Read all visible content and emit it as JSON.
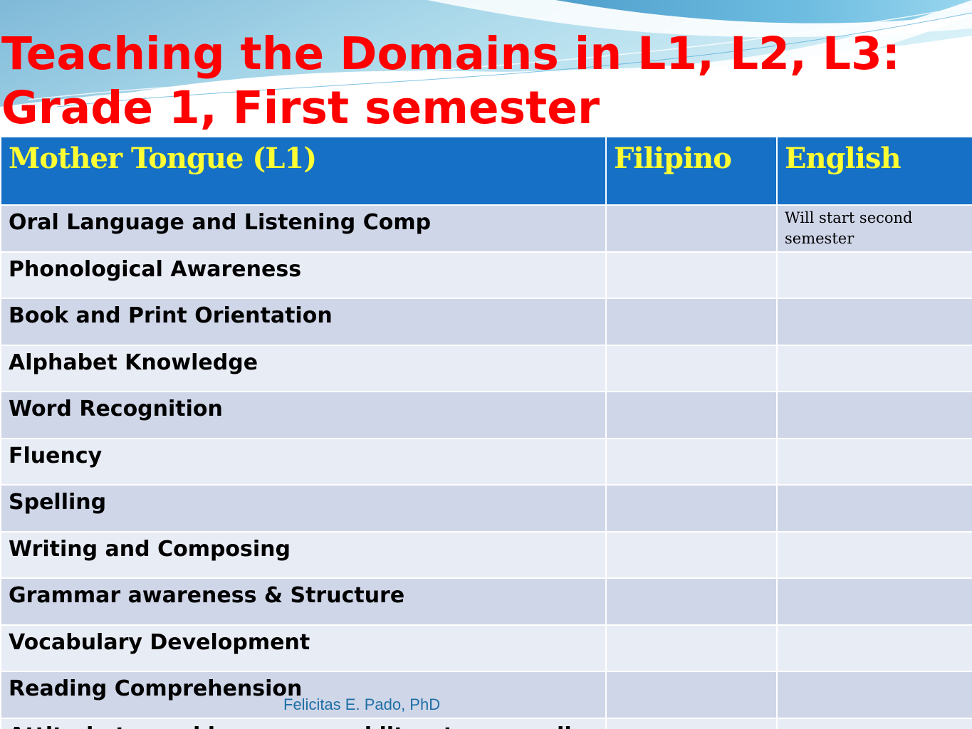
{
  "title": {
    "line1": "Teaching the Domains in L1, L2, L3:",
    "line2": "Grade 1, First semester"
  },
  "colors": {
    "title": "#ff0000",
    "header_bg": "#1570c6",
    "header_text": "#ffff33",
    "row_dark": "#cfd6e8",
    "row_light": "#e8ecf5",
    "footer": "#1e6fa5"
  },
  "table": {
    "headers": [
      "Mother Tongue  (L1)",
      "Filipino",
      "English"
    ],
    "rows": [
      {
        "domain": "Oral Language and Listening Comp",
        "filipino": "",
        "english": "Will start second semester"
      },
      {
        "domain": "Phonological Awareness",
        "filipino": "",
        "english": ""
      },
      {
        "domain": "Book and Print Orientation",
        "filipino": "",
        "english": ""
      },
      {
        "domain": "Alphabet Knowledge",
        "filipino": "",
        "english": ""
      },
      {
        "domain": "Word Recognition",
        "filipino": "",
        "english": ""
      },
      {
        "domain": "Fluency",
        "filipino": "",
        "english": ""
      },
      {
        "domain": "Spelling",
        "filipino": "",
        "english": ""
      },
      {
        "domain": "Writing and Composing",
        "filipino": "",
        "english": ""
      },
      {
        "domain": "Grammar awareness & Structure",
        "filipino": "",
        "english": ""
      },
      {
        "domain": "Vocabulary Development",
        "filipino": "",
        "english": ""
      },
      {
        "domain": "Reading Comprehension",
        "filipino": "",
        "english": ""
      },
      {
        "domain": "Attitude toward language and literature, reading",
        "filipino": "",
        "english": ""
      }
    ]
  },
  "footer": "Felicitas E. Pado, PhD"
}
